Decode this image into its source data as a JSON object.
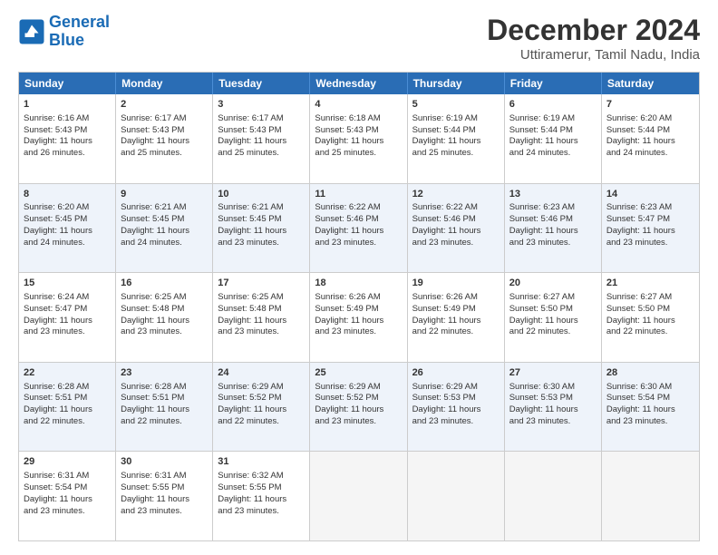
{
  "logo": {
    "line1": "General",
    "line2": "Blue"
  },
  "title": "December 2024",
  "subtitle": "Uttiramerur, Tamil Nadu, India",
  "weekdays": [
    "Sunday",
    "Monday",
    "Tuesday",
    "Wednesday",
    "Thursday",
    "Friday",
    "Saturday"
  ],
  "rows": [
    [
      {
        "day": "1",
        "lines": [
          "Sunrise: 6:16 AM",
          "Sunset: 5:43 PM",
          "Daylight: 11 hours",
          "and 26 minutes."
        ]
      },
      {
        "day": "2",
        "lines": [
          "Sunrise: 6:17 AM",
          "Sunset: 5:43 PM",
          "Daylight: 11 hours",
          "and 25 minutes."
        ]
      },
      {
        "day": "3",
        "lines": [
          "Sunrise: 6:17 AM",
          "Sunset: 5:43 PM",
          "Daylight: 11 hours",
          "and 25 minutes."
        ]
      },
      {
        "day": "4",
        "lines": [
          "Sunrise: 6:18 AM",
          "Sunset: 5:43 PM",
          "Daylight: 11 hours",
          "and 25 minutes."
        ]
      },
      {
        "day": "5",
        "lines": [
          "Sunrise: 6:19 AM",
          "Sunset: 5:44 PM",
          "Daylight: 11 hours",
          "and 25 minutes."
        ]
      },
      {
        "day": "6",
        "lines": [
          "Sunrise: 6:19 AM",
          "Sunset: 5:44 PM",
          "Daylight: 11 hours",
          "and 24 minutes."
        ]
      },
      {
        "day": "7",
        "lines": [
          "Sunrise: 6:20 AM",
          "Sunset: 5:44 PM",
          "Daylight: 11 hours",
          "and 24 minutes."
        ]
      }
    ],
    [
      {
        "day": "8",
        "lines": [
          "Sunrise: 6:20 AM",
          "Sunset: 5:45 PM",
          "Daylight: 11 hours",
          "and 24 minutes."
        ]
      },
      {
        "day": "9",
        "lines": [
          "Sunrise: 6:21 AM",
          "Sunset: 5:45 PM",
          "Daylight: 11 hours",
          "and 24 minutes."
        ]
      },
      {
        "day": "10",
        "lines": [
          "Sunrise: 6:21 AM",
          "Sunset: 5:45 PM",
          "Daylight: 11 hours",
          "and 23 minutes."
        ]
      },
      {
        "day": "11",
        "lines": [
          "Sunrise: 6:22 AM",
          "Sunset: 5:46 PM",
          "Daylight: 11 hours",
          "and 23 minutes."
        ]
      },
      {
        "day": "12",
        "lines": [
          "Sunrise: 6:22 AM",
          "Sunset: 5:46 PM",
          "Daylight: 11 hours",
          "and 23 minutes."
        ]
      },
      {
        "day": "13",
        "lines": [
          "Sunrise: 6:23 AM",
          "Sunset: 5:46 PM",
          "Daylight: 11 hours",
          "and 23 minutes."
        ]
      },
      {
        "day": "14",
        "lines": [
          "Sunrise: 6:23 AM",
          "Sunset: 5:47 PM",
          "Daylight: 11 hours",
          "and 23 minutes."
        ]
      }
    ],
    [
      {
        "day": "15",
        "lines": [
          "Sunrise: 6:24 AM",
          "Sunset: 5:47 PM",
          "Daylight: 11 hours",
          "and 23 minutes."
        ]
      },
      {
        "day": "16",
        "lines": [
          "Sunrise: 6:25 AM",
          "Sunset: 5:48 PM",
          "Daylight: 11 hours",
          "and 23 minutes."
        ]
      },
      {
        "day": "17",
        "lines": [
          "Sunrise: 6:25 AM",
          "Sunset: 5:48 PM",
          "Daylight: 11 hours",
          "and 23 minutes."
        ]
      },
      {
        "day": "18",
        "lines": [
          "Sunrise: 6:26 AM",
          "Sunset: 5:49 PM",
          "Daylight: 11 hours",
          "and 23 minutes."
        ]
      },
      {
        "day": "19",
        "lines": [
          "Sunrise: 6:26 AM",
          "Sunset: 5:49 PM",
          "Daylight: 11 hours",
          "and 22 minutes."
        ]
      },
      {
        "day": "20",
        "lines": [
          "Sunrise: 6:27 AM",
          "Sunset: 5:50 PM",
          "Daylight: 11 hours",
          "and 22 minutes."
        ]
      },
      {
        "day": "21",
        "lines": [
          "Sunrise: 6:27 AM",
          "Sunset: 5:50 PM",
          "Daylight: 11 hours",
          "and 22 minutes."
        ]
      }
    ],
    [
      {
        "day": "22",
        "lines": [
          "Sunrise: 6:28 AM",
          "Sunset: 5:51 PM",
          "Daylight: 11 hours",
          "and 22 minutes."
        ]
      },
      {
        "day": "23",
        "lines": [
          "Sunrise: 6:28 AM",
          "Sunset: 5:51 PM",
          "Daylight: 11 hours",
          "and 22 minutes."
        ]
      },
      {
        "day": "24",
        "lines": [
          "Sunrise: 6:29 AM",
          "Sunset: 5:52 PM",
          "Daylight: 11 hours",
          "and 22 minutes."
        ]
      },
      {
        "day": "25",
        "lines": [
          "Sunrise: 6:29 AM",
          "Sunset: 5:52 PM",
          "Daylight: 11 hours",
          "and 23 minutes."
        ]
      },
      {
        "day": "26",
        "lines": [
          "Sunrise: 6:29 AM",
          "Sunset: 5:53 PM",
          "Daylight: 11 hours",
          "and 23 minutes."
        ]
      },
      {
        "day": "27",
        "lines": [
          "Sunrise: 6:30 AM",
          "Sunset: 5:53 PM",
          "Daylight: 11 hours",
          "and 23 minutes."
        ]
      },
      {
        "day": "28",
        "lines": [
          "Sunrise: 6:30 AM",
          "Sunset: 5:54 PM",
          "Daylight: 11 hours",
          "and 23 minutes."
        ]
      }
    ],
    [
      {
        "day": "29",
        "lines": [
          "Sunrise: 6:31 AM",
          "Sunset: 5:54 PM",
          "Daylight: 11 hours",
          "and 23 minutes."
        ]
      },
      {
        "day": "30",
        "lines": [
          "Sunrise: 6:31 AM",
          "Sunset: 5:55 PM",
          "Daylight: 11 hours",
          "and 23 minutes."
        ]
      },
      {
        "day": "31",
        "lines": [
          "Sunrise: 6:32 AM",
          "Sunset: 5:55 PM",
          "Daylight: 11 hours",
          "and 23 minutes."
        ]
      },
      {
        "day": "",
        "lines": []
      },
      {
        "day": "",
        "lines": []
      },
      {
        "day": "",
        "lines": []
      },
      {
        "day": "",
        "lines": []
      }
    ]
  ]
}
